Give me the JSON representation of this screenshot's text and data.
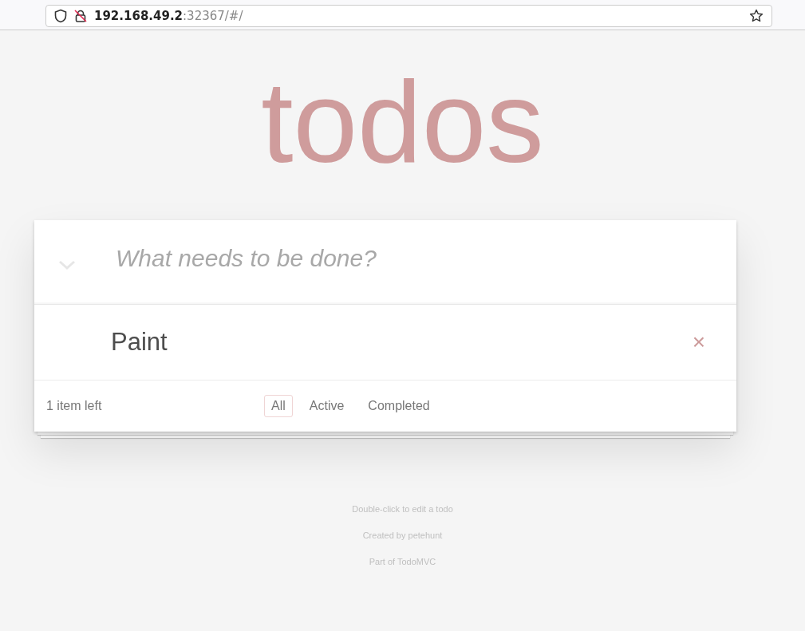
{
  "address_bar": {
    "host": "192.168.49.2",
    "rest": ":32367/#/"
  },
  "title": "todos",
  "new_todo": {
    "placeholder": "What needs to be done?"
  },
  "todos": [
    {
      "label": "Paint",
      "delete": "×"
    }
  ],
  "footer": {
    "count": "1 item left",
    "filters": [
      {
        "label": "All",
        "selected": true
      },
      {
        "label": "Active",
        "selected": false
      },
      {
        "label": "Completed",
        "selected": false
      }
    ]
  },
  "info": [
    "Double-click to edit a todo",
    "Created by petehunt",
    "Part of TodoMVC"
  ]
}
